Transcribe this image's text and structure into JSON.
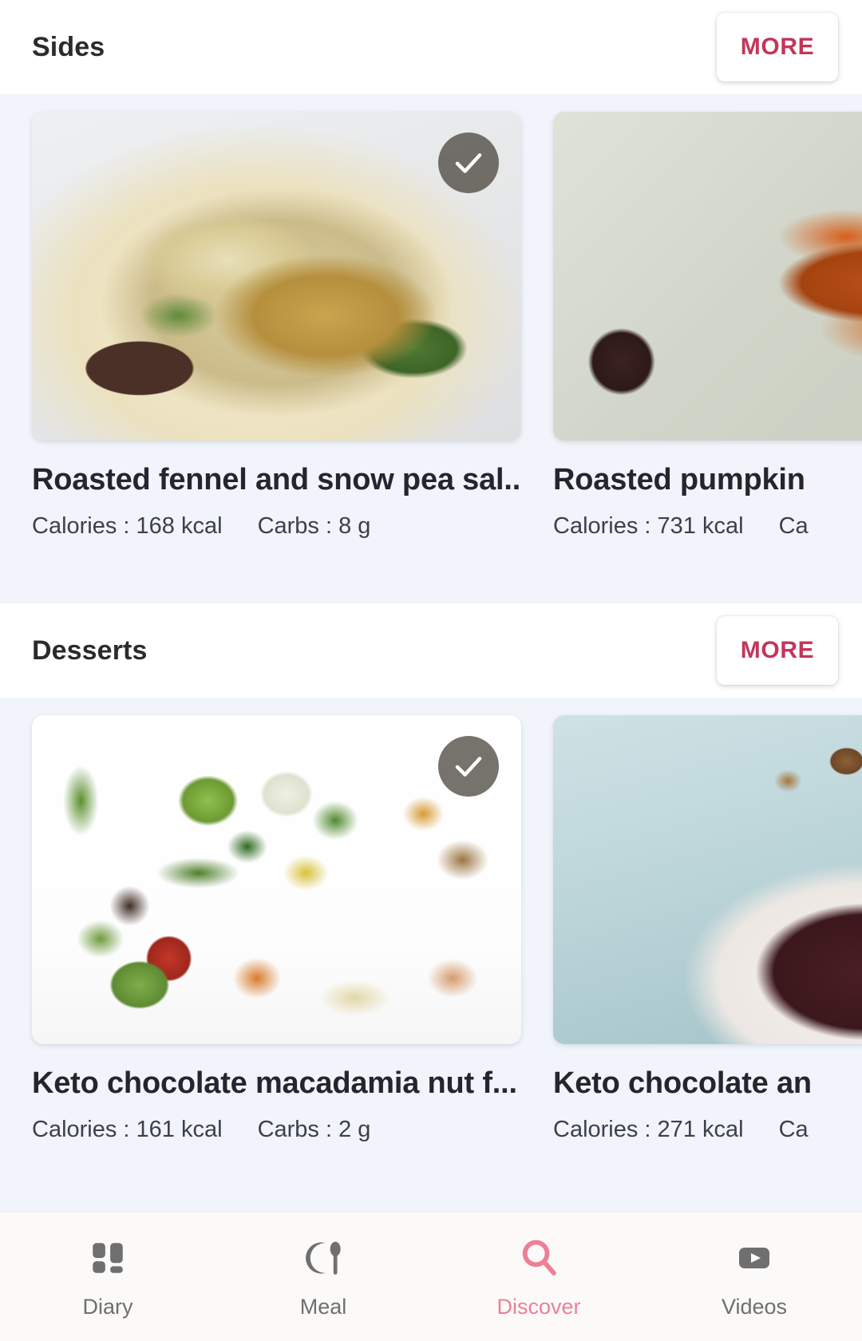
{
  "sections": [
    {
      "title": "Sides",
      "more_label": "MORE",
      "cards": [
        {
          "title": "Roasted fennel and snow pea sal...",
          "calories": "Calories : 168 kcal",
          "carbs": "Carbs : 8 g",
          "selected": true,
          "image_name": "roasted-fennel-snow-pea-salad-photo"
        },
        {
          "title": "Roasted pumpkin",
          "calories": "Calories : 731 kcal",
          "carbs": "Ca",
          "selected": false,
          "image_name": "roasted-pumpkin-photo"
        }
      ]
    },
    {
      "title": "Desserts",
      "more_label": "MORE",
      "cards": [
        {
          "title": "Keto chocolate macadamia nut f...",
          "calories": "Calories : 161 kcal",
          "carbs": "Carbs : 2 g",
          "selected": true,
          "image_name": "assorted-vegetables-photo"
        },
        {
          "title": "Keto chocolate an",
          "calories": "Calories : 271 kcal",
          "carbs": "Ca",
          "selected": false,
          "image_name": "chocolate-mousse-hazelnut-photo"
        }
      ]
    }
  ],
  "bottom_nav": {
    "items": [
      {
        "label": "Diary",
        "icon": "grid-icon",
        "active": false
      },
      {
        "label": "Meal",
        "icon": "plate-spoon-icon",
        "active": false
      },
      {
        "label": "Discover",
        "icon": "search-icon",
        "active": true
      },
      {
        "label": "Videos",
        "icon": "play-icon",
        "active": false
      }
    ]
  },
  "colors": {
    "accent": "#c2365a",
    "active_nav": "#ef7f95",
    "page_bg": "#f1f4fb",
    "card_bg": "#ffffff",
    "text_primary": "#23262d",
    "text_secondary": "#3c4049"
  }
}
